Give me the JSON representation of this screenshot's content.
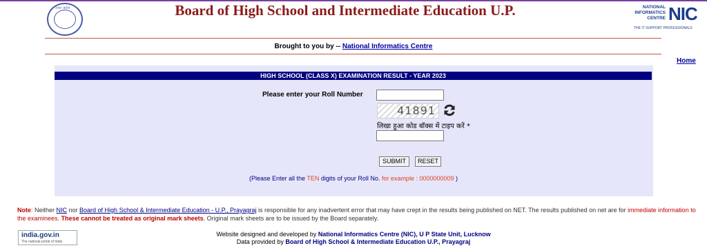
{
  "header": {
    "emblem_caption": "उत्तर प्रदेश",
    "title": "Board of High School and Intermediate Education U.P.",
    "nic_logo": {
      "line1": "NATIONAL",
      "line2": "INFORMATICS",
      "line3": "CENTRE",
      "big": "NIC",
      "tagline": "THE IT SUPPORT PROFESSIONALS"
    }
  },
  "brought_by": {
    "prefix": "Brought to you by -- ",
    "link": "National Informatics Centre"
  },
  "nav": {
    "home": "Home"
  },
  "form": {
    "heading": "HIGH SCHOOL (CLASS X)  EXAMINATION RESULT - YEAR 2023",
    "roll_label": "Please enter your Roll Number",
    "roll_value": "",
    "captcha_text": "41891",
    "captcha_label": "लिखा हुआ कोड बॉक्स में टाइप करें *",
    "captcha_value": "",
    "submit": "SUBMIT",
    "reset": "RESET",
    "hint": {
      "open": "(Please Enter all the ",
      "ten": "TEN",
      "mid": " digits of your Roll No. ",
      "example": "for example : 0000000009",
      "close": " )"
    }
  },
  "note": {
    "label": "Note",
    "part1": ": Neither ",
    "link1": "NIC",
    "part2": " nor ",
    "link2": "Board of High School & Intermediate Education - U.P., Prayagraj",
    "part3": " is responsible for any inadvertent error that may have crept in the results being published on NET. The results published on net are for ",
    "red_text": "immediate information to the examinees.",
    "space": " ",
    "red_bold": "These cannot be treated as original mark sheets",
    "period": ".",
    "part4": " Original mark sheets are to be issued by the Board separately."
  },
  "footer": {
    "badge_title": "india.gov.in",
    "badge_sub": "The national portal of India",
    "line1_prefix": "Website designed and developed by ",
    "line1_bold": "National Informatics Centre (NIC), U P State Unit, Lucknow",
    "line2_prefix": "Data provided by ",
    "line2_bold": "Board of High School & Intermediate Education U.P., Prayagraj"
  },
  "colors": {
    "title": "#8b1a1a",
    "panel_bg": "#e6e6fa",
    "panel_header": "#000080",
    "link": "#0000a0",
    "note_red": "#c00000"
  },
  "icons": [
    "up-board-emblem-icon",
    "refresh-icon",
    "nic-logo",
    "india-gov-logo"
  ]
}
